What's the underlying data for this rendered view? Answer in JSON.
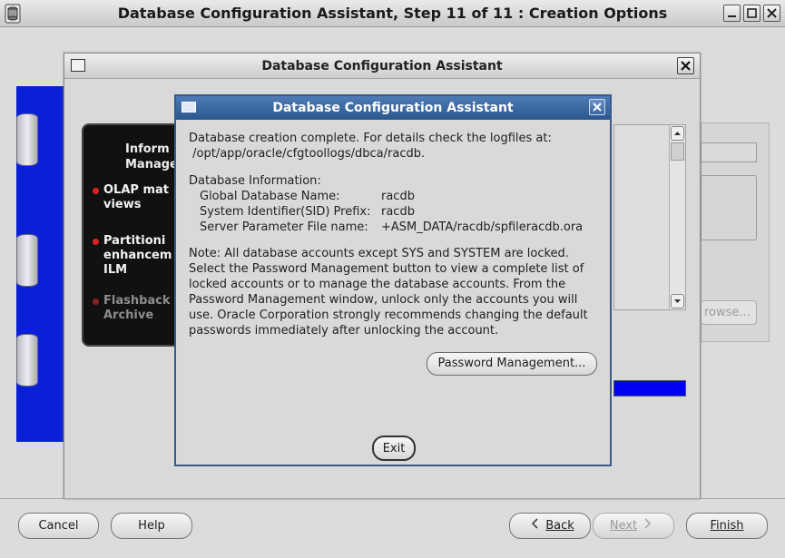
{
  "window": {
    "title": "Database Configuration Assistant, Step 11 of 11 : Creation Options"
  },
  "background": {
    "promo_heading": [
      "Inform",
      "Manager"
    ],
    "promo_items": [
      {
        "lines": [
          "OLAP mat",
          "views"
        ],
        "dim": false
      },
      {
        "lines": [
          "Partitioni",
          "enhancem",
          "ILM"
        ],
        "dim": false
      },
      {
        "lines": [
          "Flashback",
          "Archive"
        ],
        "dim": true
      }
    ],
    "browse_label": "rowse..."
  },
  "mid_dialog": {
    "title": "Database Configuration Assistant"
  },
  "dialog": {
    "title": "Database Configuration Assistant",
    "intro_line1": "Database creation complete. For details check the logfiles at:",
    "intro_line2": " /opt/app/oracle/cfgtoollogs/dbca/racdb.",
    "info_heading": "Database Information:",
    "info": [
      {
        "key": "Global Database Name:",
        "value": "racdb"
      },
      {
        "key": "System Identifier(SID) Prefix:",
        "value": "racdb"
      },
      {
        "key": "Server Parameter File name:",
        "value": "+ASM_DATA/racdb/spfileracdb.ora"
      }
    ],
    "note_lines": [
      "Note: All database accounts except SYS and SYSTEM are locked.",
      "Select the Password Management button to view a complete list of",
      "locked accounts or to manage the database accounts. From the",
      "Password Management window, unlock only the accounts you will",
      "use. Oracle Corporation strongly recommends changing the default",
      "passwords immediately after unlocking the account."
    ],
    "password_button": "Password Management...",
    "exit_button": "Exit"
  },
  "footer": {
    "cancel": "Cancel",
    "help": "Help",
    "back": "Back",
    "next": "Next",
    "finish": "Finish"
  },
  "colors": {
    "title_bar_blue": "#2b578e",
    "progress_blue": "#0000f5",
    "side_image_blue": "#0a1fd8"
  }
}
